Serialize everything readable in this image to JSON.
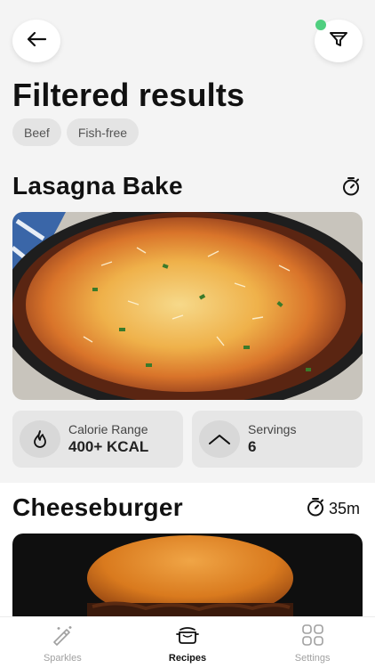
{
  "header": {
    "title": "Filtered results",
    "back_icon": "arrow-left-icon",
    "filter_icon": "funnel-icon",
    "filter_active_color": "#4fcf7f"
  },
  "filters": [
    "Beef",
    "Fish-free"
  ],
  "recipes": [
    {
      "name": "Lasagna Bake",
      "time": "",
      "stats": [
        {
          "icon": "flame-icon",
          "label": "Calorie Range",
          "value": "400+ KCAL"
        },
        {
          "icon": "chevron-up-icon",
          "label": "Servings",
          "value": "6"
        }
      ]
    },
    {
      "name": "Cheeseburger",
      "time": "35m"
    }
  ],
  "tabbar": {
    "items": [
      {
        "label": "Sparkles",
        "icon": "magic-wand-icon",
        "active": false
      },
      {
        "label": "Recipes",
        "icon": "pot-icon",
        "active": true
      },
      {
        "label": "Settings",
        "icon": "grid-icon",
        "active": false
      }
    ]
  },
  "colors": {
    "background": "#f4f4f4",
    "chip_bg": "#e4e4e4",
    "stat_bg": "#e6e6e6",
    "active_tab": "#111111",
    "inactive_tab": "#a0a0a0"
  }
}
